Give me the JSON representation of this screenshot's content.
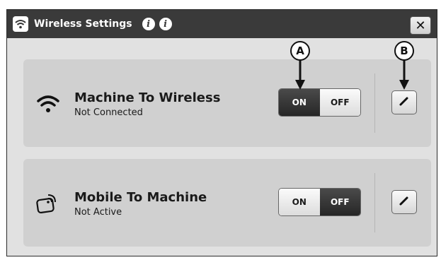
{
  "window": {
    "title": "Wireless Settings",
    "close_label": "✕",
    "title_icon": "wifi-icon",
    "info_icons": [
      "info-icon",
      "info-icon"
    ]
  },
  "rows": [
    {
      "icon": "wifi-icon",
      "title": "Machine To Wireless",
      "status": "Not Connected",
      "on_label": "ON",
      "off_label": "OFF",
      "state": "ON",
      "edit_icon": "pencil-icon"
    },
    {
      "icon": "mobile-wireless-icon",
      "title": "Mobile To Machine",
      "status": "Not Active",
      "on_label": "ON",
      "off_label": "OFF",
      "state": "OFF",
      "edit_icon": "pencil-icon"
    }
  ],
  "callouts": {
    "a": "A",
    "b": "B"
  },
  "colors": {
    "titlebar": "#3a3a3a",
    "panel": "#d0d0d0",
    "active_segment": "#2e2e2e"
  }
}
